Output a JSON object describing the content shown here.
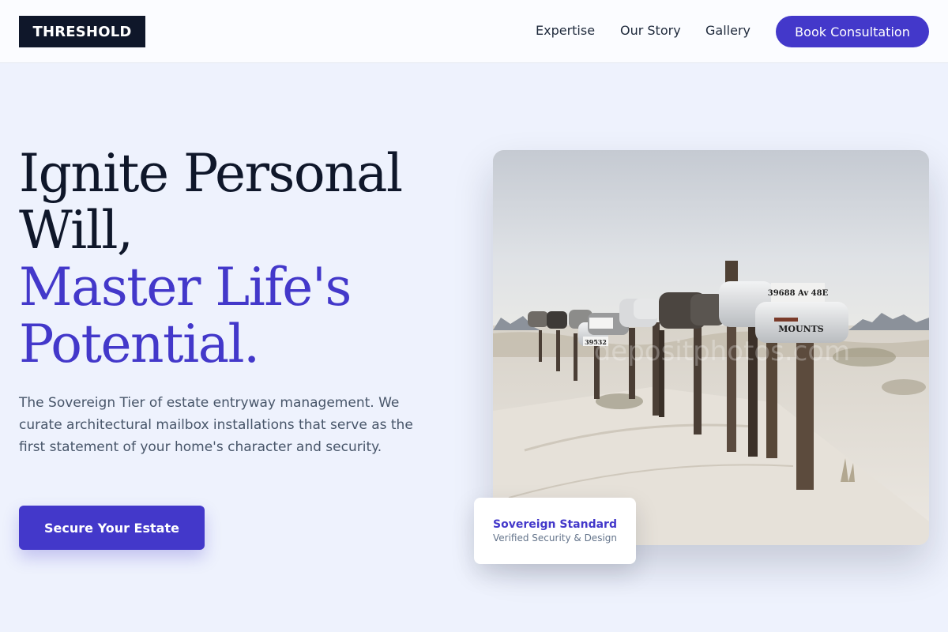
{
  "header": {
    "logo_text": "THRESHOLD",
    "nav": [
      {
        "label": "Expertise"
      },
      {
        "label": "Our Story"
      },
      {
        "label": "Gallery"
      }
    ],
    "cta_label": "Book Consultation"
  },
  "hero": {
    "title_line1": "Ignite Personal",
    "title_line2": "Will,",
    "title_accent_line1": "Master Life's",
    "title_accent_line2": "Potential.",
    "description": "The Sovereign Tier of estate entryway management. We curate architectural mailbox installations that serve as the first statement of your home's character and security.",
    "cta_label": "Secure Your Estate",
    "image": {
      "mailbox_labels": [
        "39688 Av 48E",
        "MOUNTS",
        "39532"
      ],
      "watermark": "depositphotos.com"
    },
    "badge": {
      "title": "Sovereign Standard",
      "subtitle": "Verified Security & Design"
    }
  },
  "colors": {
    "accent": "#4338ca",
    "ink": "#0f172a",
    "background": "#eef2fd",
    "body_text": "#475569"
  }
}
